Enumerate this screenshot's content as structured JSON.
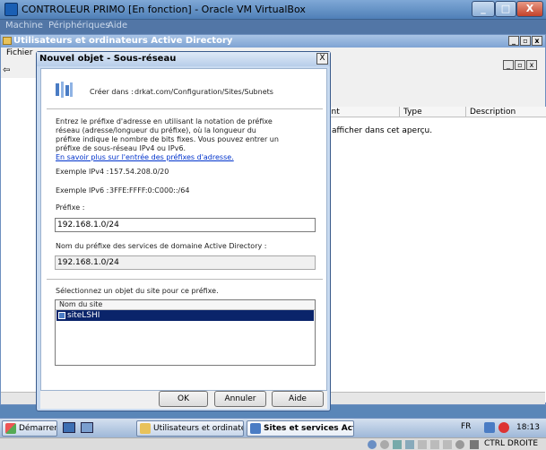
{
  "vbox": {
    "title": "CONTROLEUR PRIMO [En fonction] - Oracle VM VirtualBox",
    "menu": [
      "Machine",
      "Périphériques",
      "Aide"
    ],
    "minimize": "_",
    "maximize": "□",
    "close": "X"
  },
  "aduc": {
    "title": "Utilisateurs et ordinateurs Active Directory",
    "menu_fichier": "Fichier",
    "columns": [
      "ent",
      "Type",
      "Description"
    ],
    "empty_text": "afficher dans cet aperçu."
  },
  "dialog": {
    "title": "Nouvel objet - Sous-réseau",
    "close": "X",
    "created_in_label": "Créer dans :",
    "created_in_value": "drkat.com/Configuration/Sites/Subnets",
    "instructions": "Entrez le préfixe d'adresse en utilisant la notation de préfixe réseau (adresse/longueur du préfixe), où la longueur du préfixe indique le nombre de bits fixes. Vous pouvez entrer un préfixe de sous-réseau IPv4 ou IPv6.",
    "learn_more_link": "En savoir plus sur l'entrée des préfixes d'adresse.",
    "example_ipv4_label": "Exemple IPv4 :",
    "example_ipv4_value": "157.54.208.0/20",
    "example_ipv6_label": "Exemple IPv6 :",
    "example_ipv6_value": "3FFE:FFFF:0:C000::/64",
    "prefix_label": "Préfixe :",
    "prefix_value": "192.168.1.0/24",
    "ad_prefix_label": "Nom du préfixe des services de domaine Active Directory :",
    "ad_prefix_value": "192.168.1.0/24",
    "site_select_label": "Sélectionnez un objet du site pour ce préfixe.",
    "site_column": "Nom du site",
    "sites": [
      "siteLSHI"
    ],
    "ok": "OK",
    "cancel": "Annuler",
    "help": "Aide"
  },
  "taskbar": {
    "start": "Démarrer",
    "items": [
      "Utilisateurs et ordinateur...",
      "Sites et services Acti..."
    ],
    "lang": "FR",
    "time": "18:13"
  },
  "statusbar": {
    "host_key": "CTRL DROITE"
  },
  "colors": {
    "selection": "#0a246a",
    "link": "#0033cc"
  }
}
